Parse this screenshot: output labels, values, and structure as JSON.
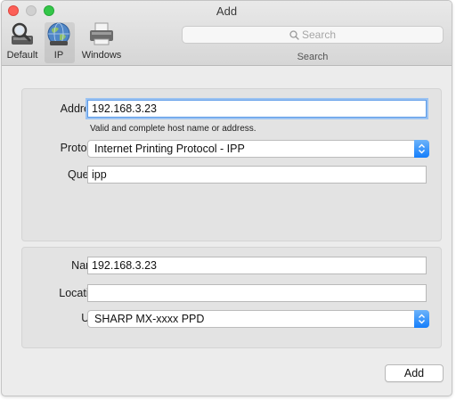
{
  "window": {
    "title": "Add"
  },
  "toolbar": {
    "items": [
      {
        "label": "Default",
        "icon": "default-printer-icon"
      },
      {
        "label": "IP",
        "icon": "globe-icon"
      },
      {
        "label": "Windows",
        "icon": "windows-printer-icon"
      }
    ],
    "selected": "IP",
    "search": {
      "placeholder": "Search",
      "caption": "Search",
      "icon": "search-icon"
    }
  },
  "connection": {
    "address_label": "Address:",
    "address_value": "192.168.3.23",
    "address_hint": "Valid and complete host name or address.",
    "protocol_label": "Protocol:",
    "protocol_value": "Internet Printing Protocol - IPP",
    "queue_label": "Queue:",
    "queue_value": "ipp"
  },
  "printer": {
    "name_label": "Name:",
    "name_value": "192.168.3.23",
    "location_label": "Location:",
    "location_value": "",
    "use_label": "Use:",
    "use_value": "SHARP MX-xxxx PPD"
  },
  "footer": {
    "add_label": "Add"
  },
  "colors": {
    "accent": "#157efb",
    "focus_ring": "#9cc3f2",
    "close": "#fc5f57",
    "zoom": "#33c648"
  }
}
